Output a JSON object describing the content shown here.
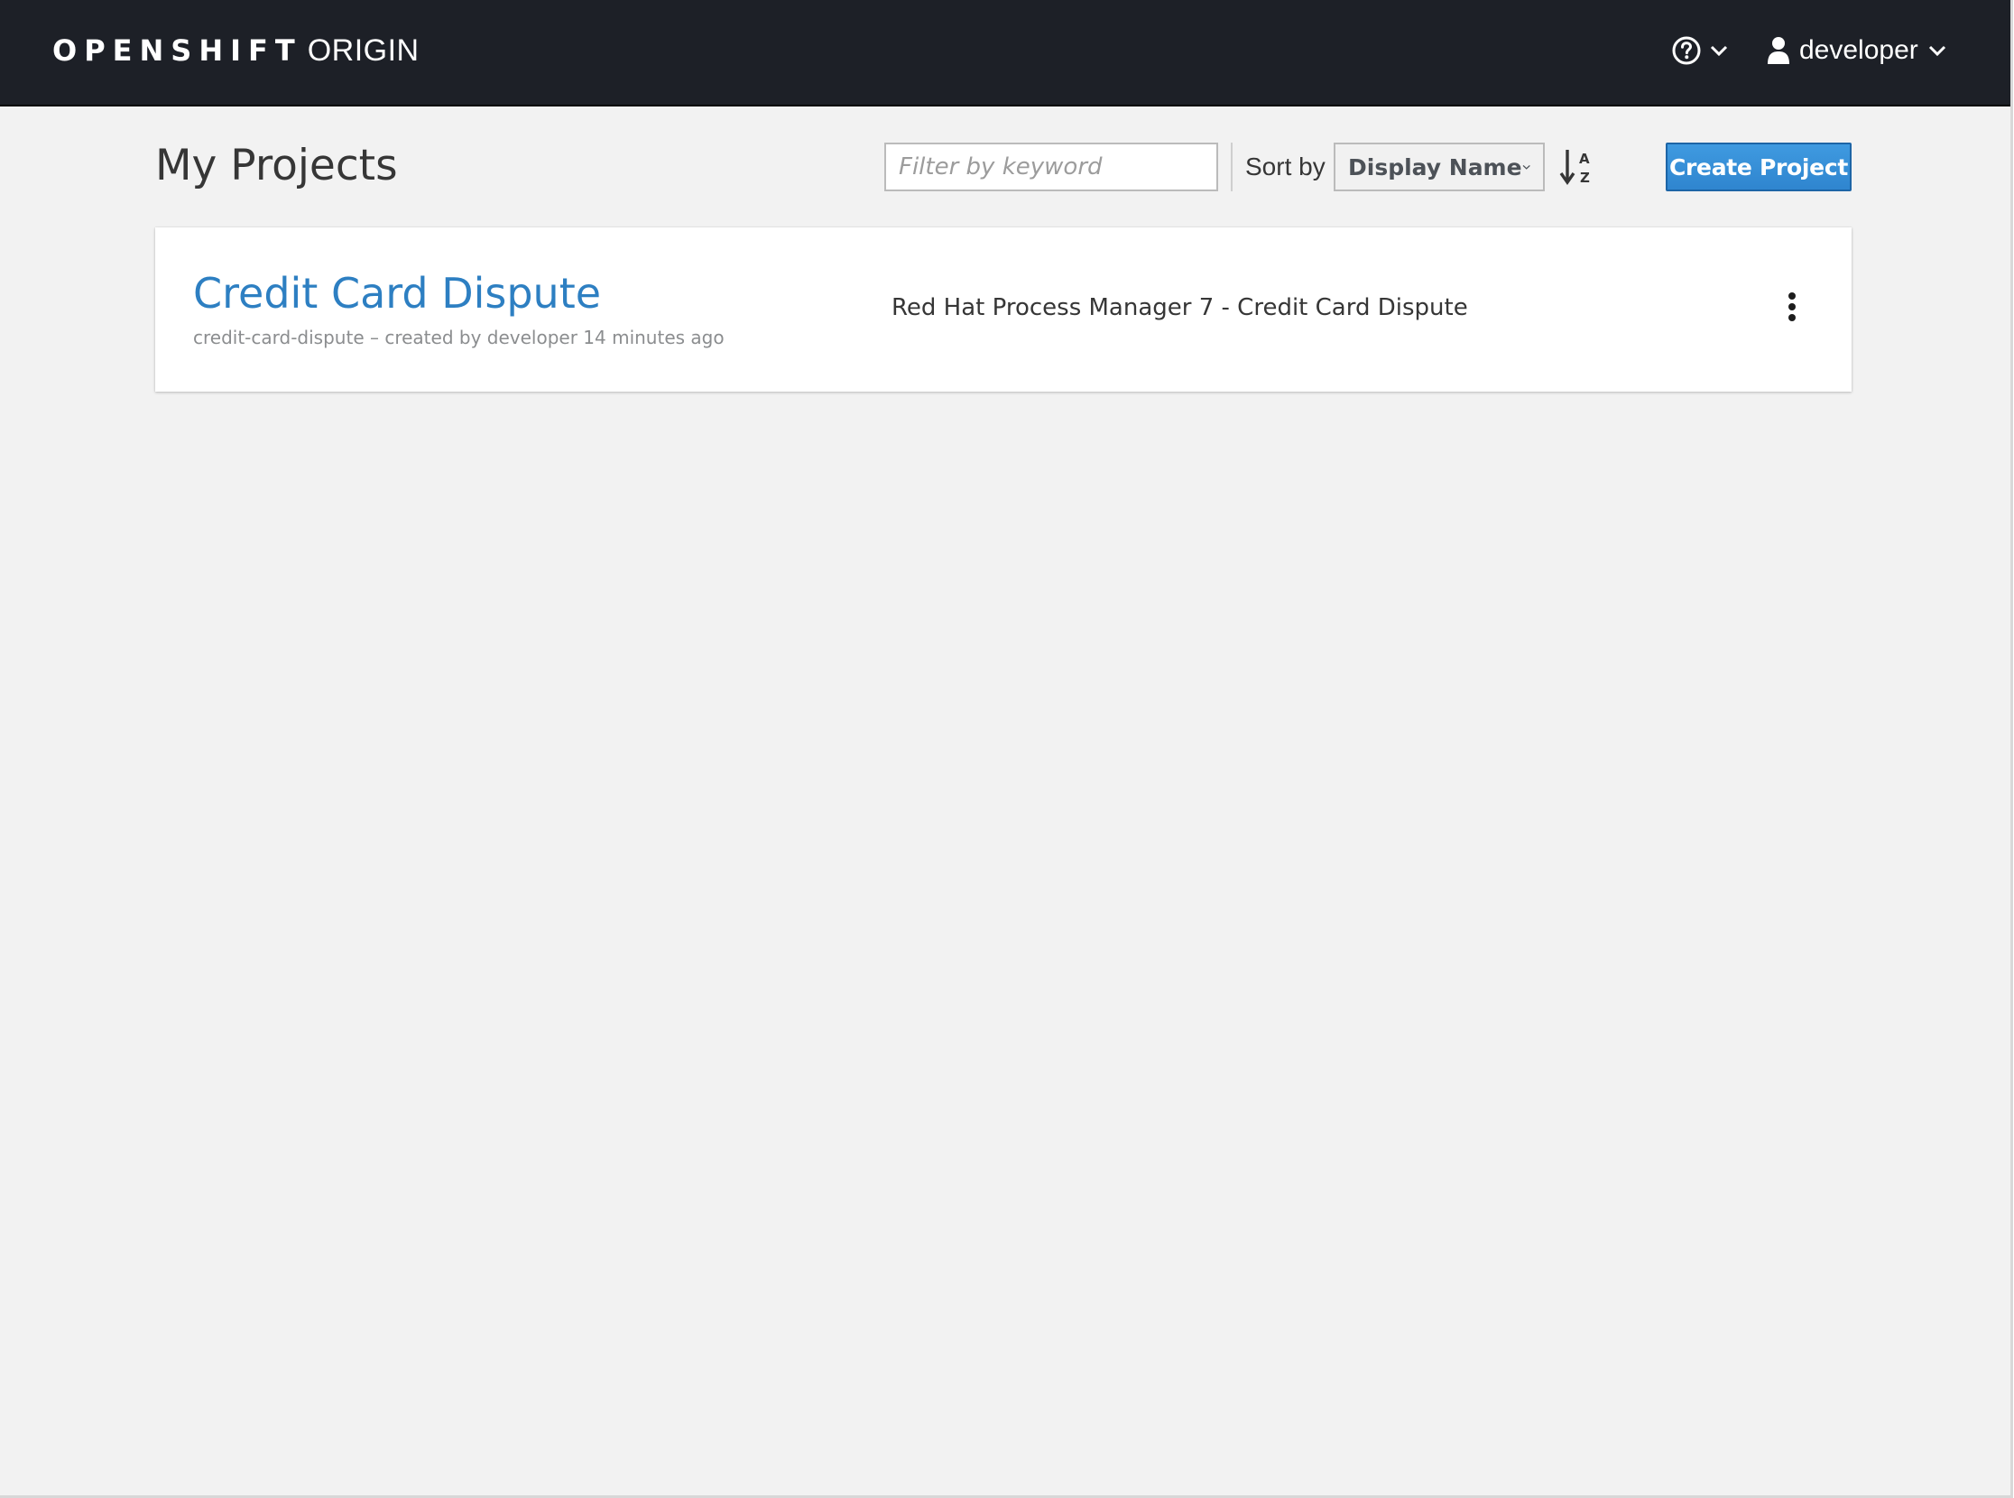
{
  "masthead": {
    "brand_strong": "OPENSHIFT",
    "brand_light": "ORIGIN",
    "help_icon": "question-circle-icon",
    "user_icon": "user-icon",
    "user_name": "developer"
  },
  "page": {
    "title": "My Projects"
  },
  "toolbar": {
    "filter_placeholder": "Filter by keyword",
    "filter_value": "",
    "sort_label": "Sort by",
    "sort_selected": "Display Name",
    "sort_order_icon": "sort-alpha-asc-icon",
    "create_label": "Create Project"
  },
  "projects": [
    {
      "display_name": "Credit Card Dispute",
      "meta": "credit-card-dispute – created by developer 14 minutes ago",
      "description": "Red Hat Process Manager 7 - Credit Card Dispute",
      "actions_icon": "kebab-menu-icon"
    }
  ],
  "colors": {
    "masthead_bg": "#1d2027",
    "page_bg": "#f2f2f2",
    "primary_button": "#3089d1",
    "link": "#2d7fc2"
  }
}
